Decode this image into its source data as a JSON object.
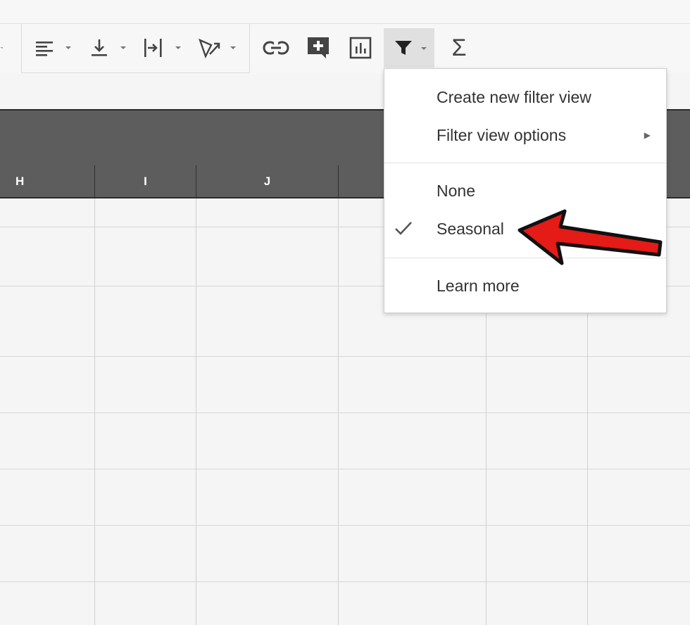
{
  "toolbar": {
    "buttons": [
      {
        "name": "horizontal-align",
        "icon": "align-left-icon",
        "has_dropdown": true
      },
      {
        "name": "vertical-align",
        "icon": "align-bottom-icon",
        "has_dropdown": true
      },
      {
        "name": "text-wrapping",
        "icon": "text-wrap-icon",
        "has_dropdown": true
      },
      {
        "name": "text-rotation",
        "icon": "text-rotate-icon",
        "has_dropdown": true
      },
      {
        "name": "insert-link",
        "icon": "link-icon",
        "has_dropdown": false
      },
      {
        "name": "insert-comment",
        "icon": "add-comment-icon",
        "has_dropdown": false
      },
      {
        "name": "insert-chart",
        "icon": "chart-icon",
        "has_dropdown": false
      },
      {
        "name": "create-filter",
        "icon": "filter-icon",
        "has_dropdown": true,
        "active": true
      },
      {
        "name": "functions",
        "icon": "sigma-icon",
        "label": "Σ",
        "has_dropdown": false
      }
    ]
  },
  "columns": [
    {
      "letter": "H"
    },
    {
      "letter": "I"
    },
    {
      "letter": "J"
    },
    {
      "letter": ""
    }
  ],
  "filter_menu": {
    "items": [
      {
        "label": "Create new filter view",
        "checked": false,
        "has_submenu": false
      },
      {
        "label": "Filter view options",
        "checked": false,
        "has_submenu": true
      },
      {
        "label": "None",
        "checked": false,
        "has_submenu": false
      },
      {
        "label": "Seasonal",
        "checked": true,
        "has_submenu": false
      },
      {
        "label": "Learn more",
        "checked": false,
        "has_submenu": false
      }
    ]
  },
  "colors": {
    "header_bg": "#5d5d5d",
    "annotation_arrow": "#e41b17",
    "menu_bg": "#ffffff"
  }
}
